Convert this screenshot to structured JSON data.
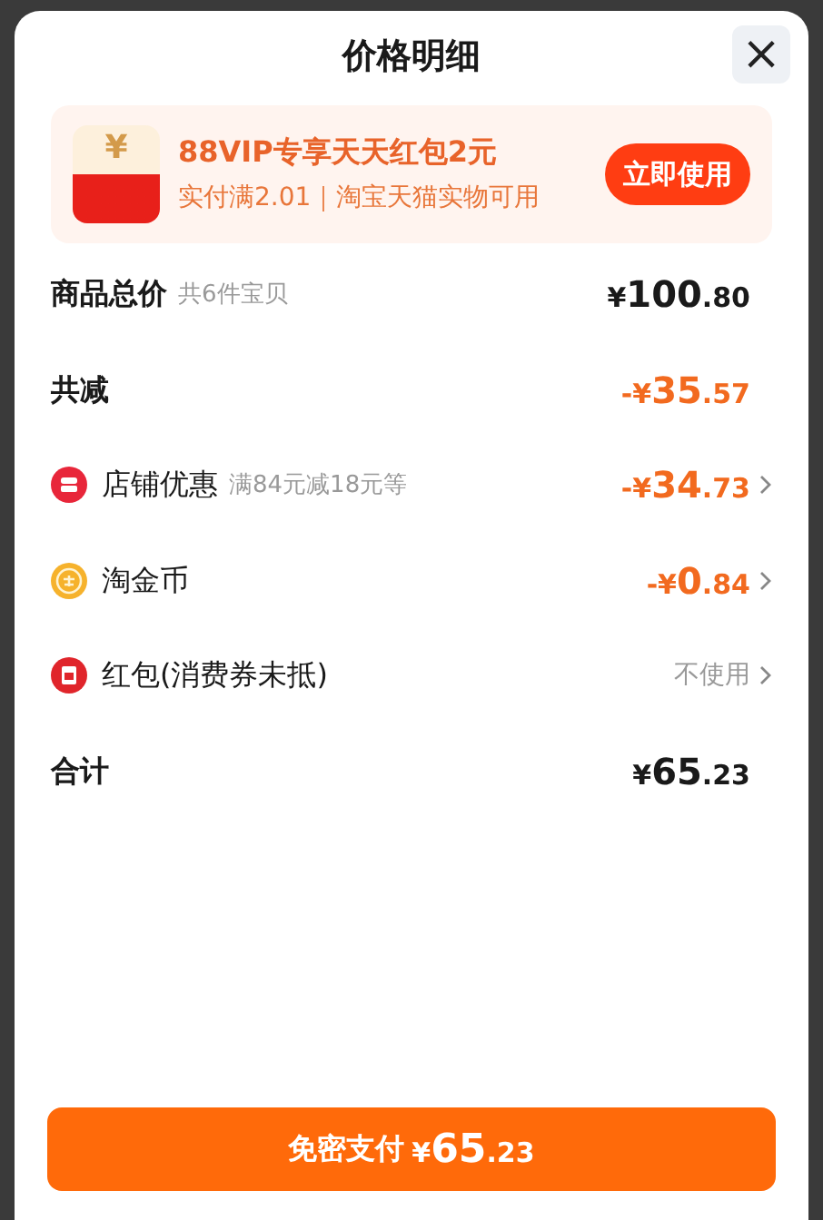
{
  "sheet": {
    "title": "价格明细",
    "close": "×"
  },
  "promo": {
    "icon_glyph": "¥",
    "title": "88VIP专享天天红包2元",
    "subtitle": "实付满2.01｜淘宝天猫实物可用",
    "button": "立即使用"
  },
  "rows": [
    {
      "kind": "summary",
      "label": "商品总价",
      "note": "共6件宝贝",
      "amount": {
        "sign": "¥",
        "whole": "100",
        "cents": ".80"
      },
      "discount": false,
      "chevron": false
    },
    {
      "kind": "summary",
      "label": "共减",
      "amount": {
        "sign": "-¥",
        "whole": "35",
        "cents": ".57"
      },
      "discount": true,
      "chevron": false
    },
    {
      "kind": "shop",
      "label": "店铺优惠",
      "note": "满84元减18元等",
      "amount": {
        "sign": "-¥",
        "whole": "34",
        "cents": ".73"
      },
      "discount": true,
      "chevron": true
    },
    {
      "kind": "coin",
      "label": "淘金币",
      "amount": {
        "sign": "-¥",
        "whole": "0",
        "cents": ".84"
      },
      "discount": true,
      "chevron": true
    },
    {
      "kind": "packet",
      "label": "红包(消费券未抵)",
      "value": "不使用",
      "chevron": true
    },
    {
      "kind": "summary",
      "label": "合计",
      "amount": {
        "sign": "¥",
        "whole": "65",
        "cents": ".23"
      },
      "discount": false,
      "chevron": false
    }
  ],
  "pay_button": {
    "label": "免密支付",
    "amount": {
      "sign": "¥",
      "whole": "65",
      "cents": ".23"
    }
  }
}
